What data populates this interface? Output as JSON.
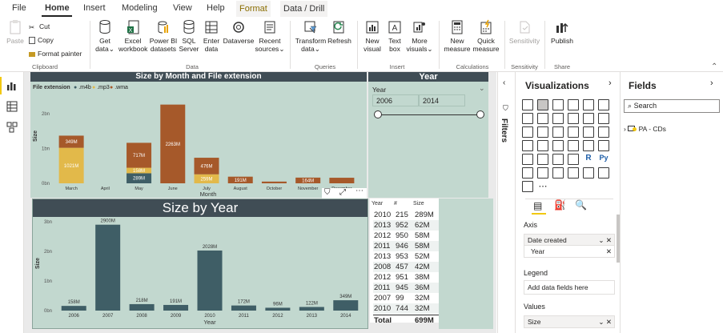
{
  "menu": {
    "tabs": [
      "File",
      "Home",
      "Insert",
      "Modeling",
      "View",
      "Help",
      "Format",
      "Data / Drill"
    ]
  },
  "ribbon": {
    "clipboard": {
      "paste": "Paste",
      "cut": "Cut",
      "copy": "Copy",
      "format_painter": "Format painter",
      "group": "Clipboard"
    },
    "data": {
      "get_data": [
        "Get",
        "data"
      ],
      "excel": [
        "Excel",
        "workbook"
      ],
      "powerbi": [
        "Power BI",
        "datasets"
      ],
      "sql": [
        "SQL",
        "Server"
      ],
      "enter": [
        "Enter",
        "data"
      ],
      "dataverse": "Dataverse",
      "recent": [
        "Recent",
        "sources"
      ],
      "group": "Data"
    },
    "queries": {
      "transform": [
        "Transform",
        "data"
      ],
      "refresh": "Refresh",
      "group": "Queries"
    },
    "insert": {
      "new_visual": [
        "New",
        "visual"
      ],
      "text_box": [
        "Text",
        "box"
      ],
      "more_visuals": [
        "More",
        "visuals"
      ],
      "group": "Insert"
    },
    "calculations": {
      "new_measure": [
        "New",
        "measure"
      ],
      "quick_measure": [
        "Quick",
        "measure"
      ],
      "group": "Calculations"
    },
    "sensitivity": {
      "label": "Sensitivity",
      "group": "Sensitivity"
    },
    "share": {
      "publish": "Publish",
      "group": "Share"
    }
  },
  "colors": {
    "m4b": "#3f5e66",
    "mp3": "#e2b94a",
    "wma": "#a6592a",
    "bar": "#3f5e66",
    "visual_bg": "#c2d8cf",
    "title_bg": "#404d55"
  },
  "chart_data": [
    {
      "type": "bar",
      "title": "Size by Month and File extension",
      "legend_title": "File extension",
      "legend": [
        ".m4b",
        ".mp3",
        ".wma"
      ],
      "xlabel": "Month",
      "ylabel": "Size",
      "yticks": [
        "0bn",
        "1bn",
        "2bn"
      ],
      "ylim": [
        0,
        2.6
      ],
      "categories": [
        "March",
        "April",
        "May",
        "June",
        "July",
        "August",
        "October",
        "November",
        "December"
      ],
      "series": [
        {
          "name": ".m4b",
          "values": [
            0,
            0,
            0.289,
            0,
            0,
            0,
            0,
            0,
            0
          ]
        },
        {
          "name": ".mp3",
          "values": [
            1.021,
            0,
            0.158,
            0,
            0.259,
            0,
            0,
            0,
            0
          ]
        },
        {
          "name": ".wma",
          "values": [
            0.349,
            0,
            0.717,
            2.263,
            0.476,
            0.191,
            0.05,
            0.164,
            0.16
          ]
        }
      ],
      "data_labels": [
        {
          "category": "March",
          "series": ".wma",
          "text": "349M"
        },
        {
          "category": "March",
          "series": ".mp3",
          "text": "1021M"
        },
        {
          "category": "May",
          "series": ".wma",
          "text": "717M"
        },
        {
          "category": "May",
          "series": ".mp3",
          "text": "158M"
        },
        {
          "category": "May",
          "series": ".m4b",
          "text": "289M"
        },
        {
          "category": "June",
          "series": ".wma",
          "text": "2263M"
        },
        {
          "category": "July",
          "series": ".wma",
          "text": "476M"
        },
        {
          "category": "July",
          "series": ".mp3",
          "text": "259M"
        },
        {
          "category": "August",
          "series": ".wma",
          "text": "191M"
        },
        {
          "category": "November",
          "series": ".wma",
          "text": "164M"
        }
      ]
    },
    {
      "type": "bar",
      "title": "Size by Year",
      "xlabel": "Year",
      "ylabel": "Size",
      "yticks": [
        "0bn",
        "1bn",
        "2bn",
        "3bn"
      ],
      "ylim": [
        0,
        3
      ],
      "categories": [
        "2006",
        "2007",
        "2008",
        "2009",
        "2010",
        "2011",
        "2012",
        "2013",
        "2014"
      ],
      "values": [
        0.158,
        2.9,
        0.218,
        0.191,
        2.028,
        0.172,
        0.096,
        0.122,
        0.349
      ],
      "labels": [
        "158M",
        "2900M",
        "218M",
        "191M",
        "2028M",
        "172M",
        "96M",
        "122M",
        "349M"
      ]
    },
    {
      "type": "table",
      "columns": [
        "Year",
        "#",
        "Size"
      ],
      "rows": [
        [
          "2010",
          "215",
          "289M"
        ],
        [
          "2013",
          "952",
          "62M"
        ],
        [
          "2012",
          "950",
          "58M"
        ],
        [
          "2011",
          "946",
          "58M"
        ],
        [
          "2013",
          "953",
          "52M"
        ],
        [
          "2008",
          "457",
          "42M"
        ],
        [
          "2012",
          "951",
          "38M"
        ],
        [
          "2011",
          "945",
          "36M"
        ],
        [
          "2007",
          "99",
          "32M"
        ],
        [
          "2010",
          "744",
          "32M"
        ]
      ],
      "total_label": "Total",
      "total_value": "699M"
    }
  ],
  "slicer": {
    "title": "Year",
    "field": "Year",
    "from": "2006",
    "to": "2014"
  },
  "filters_pane": {
    "label": "Filters"
  },
  "visualizations": {
    "title": "Visualizations",
    "wells": {
      "axis": "Axis",
      "axis_field": "Date created",
      "axis_sub": "Year",
      "legend": "Legend",
      "legend_placeholder": "Add data fields here",
      "values": "Values",
      "values_field": "Size"
    }
  },
  "fields": {
    "title": "Fields",
    "search_placeholder": "Search",
    "table": "PA - CDs"
  }
}
